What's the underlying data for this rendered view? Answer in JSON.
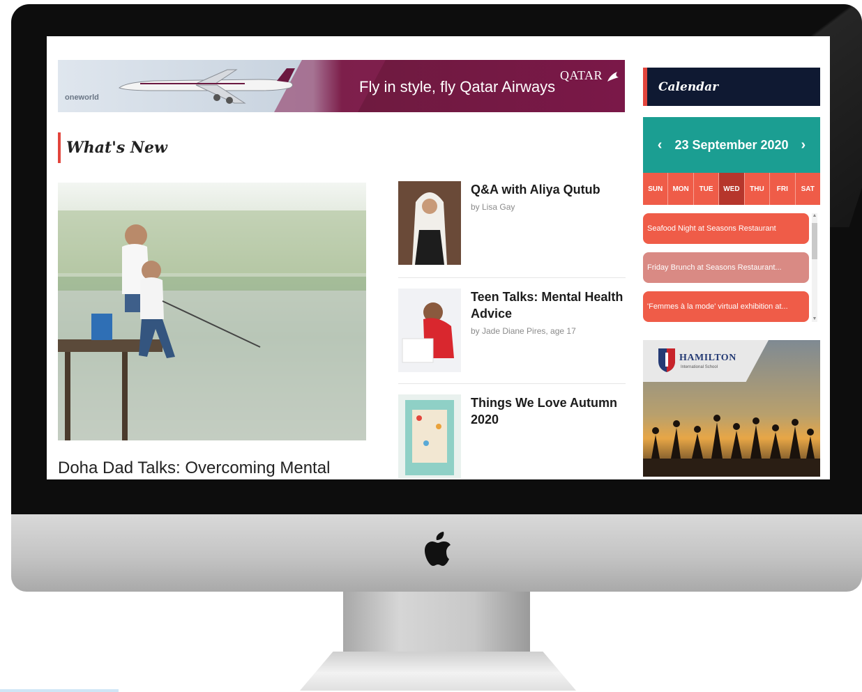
{
  "ad_banner": {
    "brand_small": "oneworld",
    "slogan": "Fly in style, fly Qatar Airways",
    "logo_text": "QATAR"
  },
  "section": {
    "title": "What's New"
  },
  "feature": {
    "title": "Doha Dad Talks: Overcoming Mental"
  },
  "articles": [
    {
      "title": "Q&A with Aliya Qutub",
      "byline": "by Lisa Gay"
    },
    {
      "title": "Teen Talks: Mental Health Advice",
      "byline": "by Jade Diane Pires, age 17"
    },
    {
      "title": "Things We Love Autumn 2020",
      "byline": ""
    }
  ],
  "calendar": {
    "title": "Calendar",
    "date": "23 September 2020",
    "prev": "‹",
    "next": "›",
    "days": [
      "SUN",
      "MON",
      "TUE",
      "WED",
      "THU",
      "FRI",
      "SAT"
    ],
    "active_day": "WED",
    "events": [
      {
        "label": "Seafood Night at Seasons Restaurant",
        "color": "#ef5c48"
      },
      {
        "label": "Friday Brunch at Seasons Restaurant...",
        "color": "#d98a84"
      },
      {
        "label": "'Femmes à la mode' virtual exhibition at...",
        "color": "#ef5c48"
      }
    ]
  },
  "sidebar_ad": {
    "name": "HAMILTON",
    "subtitle": "International School"
  },
  "colors": {
    "accent_red": "#e2453c",
    "teal": "#1b9e92",
    "navy": "#0f1932",
    "qatar_maroon": "#7a1848"
  }
}
